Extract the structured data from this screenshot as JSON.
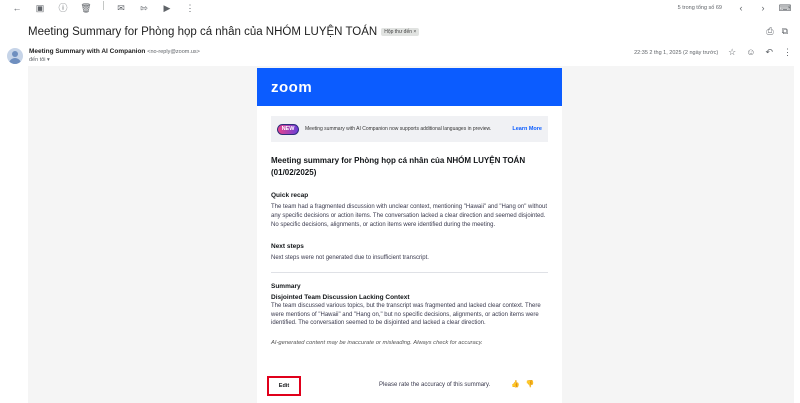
{
  "toolbar": {
    "pager": "5 trong tổng số 69",
    "icons_left": [
      "back-icon",
      "archive-icon",
      "report-icon",
      "delete-icon",
      "mark-unread-icon",
      "move-icon",
      "label-icon",
      "more-icon"
    ],
    "icons_right": [
      "prev-icon",
      "next-icon",
      "keyboard-icon"
    ]
  },
  "subject": {
    "text": "Meeting Summary for Phòng họp cá nhân của NHÓM LUYỆN TOÁN",
    "label_chip": "Hộp thư đến ×"
  },
  "sender": {
    "name": "Meeting Summary with AI Companion",
    "email": "<no-reply@zoom.us>",
    "to": "đến tôi ▾",
    "datetime": "22:35 2 thg 1, 2025 (2 ngày trước)"
  },
  "email": {
    "logo": "zoom",
    "banner": {
      "badge": "NEW",
      "text": "Meeting summary with AI Companion now supports additional languages in preview.",
      "link": "Learn More"
    },
    "title": "Meeting summary for Phòng họp cá nhân của NHÓM LUYỆN TOÁN (01/02/2025)",
    "quick_recap": {
      "heading": "Quick recap",
      "text": "The team had a fragmented discussion with unclear context, mentioning \"Hawaii\" and \"Hang on\" without any specific decisions or action items. The conversation lacked a clear direction and seemed disjointed. No specific decisions, alignments, or action items were identified during the meeting."
    },
    "next_steps": {
      "heading": "Next steps",
      "text": "Next steps were not generated due to insufficient transcript."
    },
    "summary": {
      "heading": "Summary",
      "subheading": "Disjointed Team Discussion Lacking Context",
      "text": "The team discussed various topics, but the transcript was fragmented and lacked clear context. There were mentions of \"Hawaii\" and \"Hang on,\" but no specific decisions, alignments, or action items were identified. The conversation seemed to be disjointed and lacked a clear direction."
    },
    "disclaimer": "AI-generated content may be inaccurate or misleading. Always check for accuracy.",
    "edit_label": "Edit",
    "rate_text": "Please rate the accuracy of this summary.",
    "thumb_up": "👍",
    "thumb_down": "👎"
  }
}
